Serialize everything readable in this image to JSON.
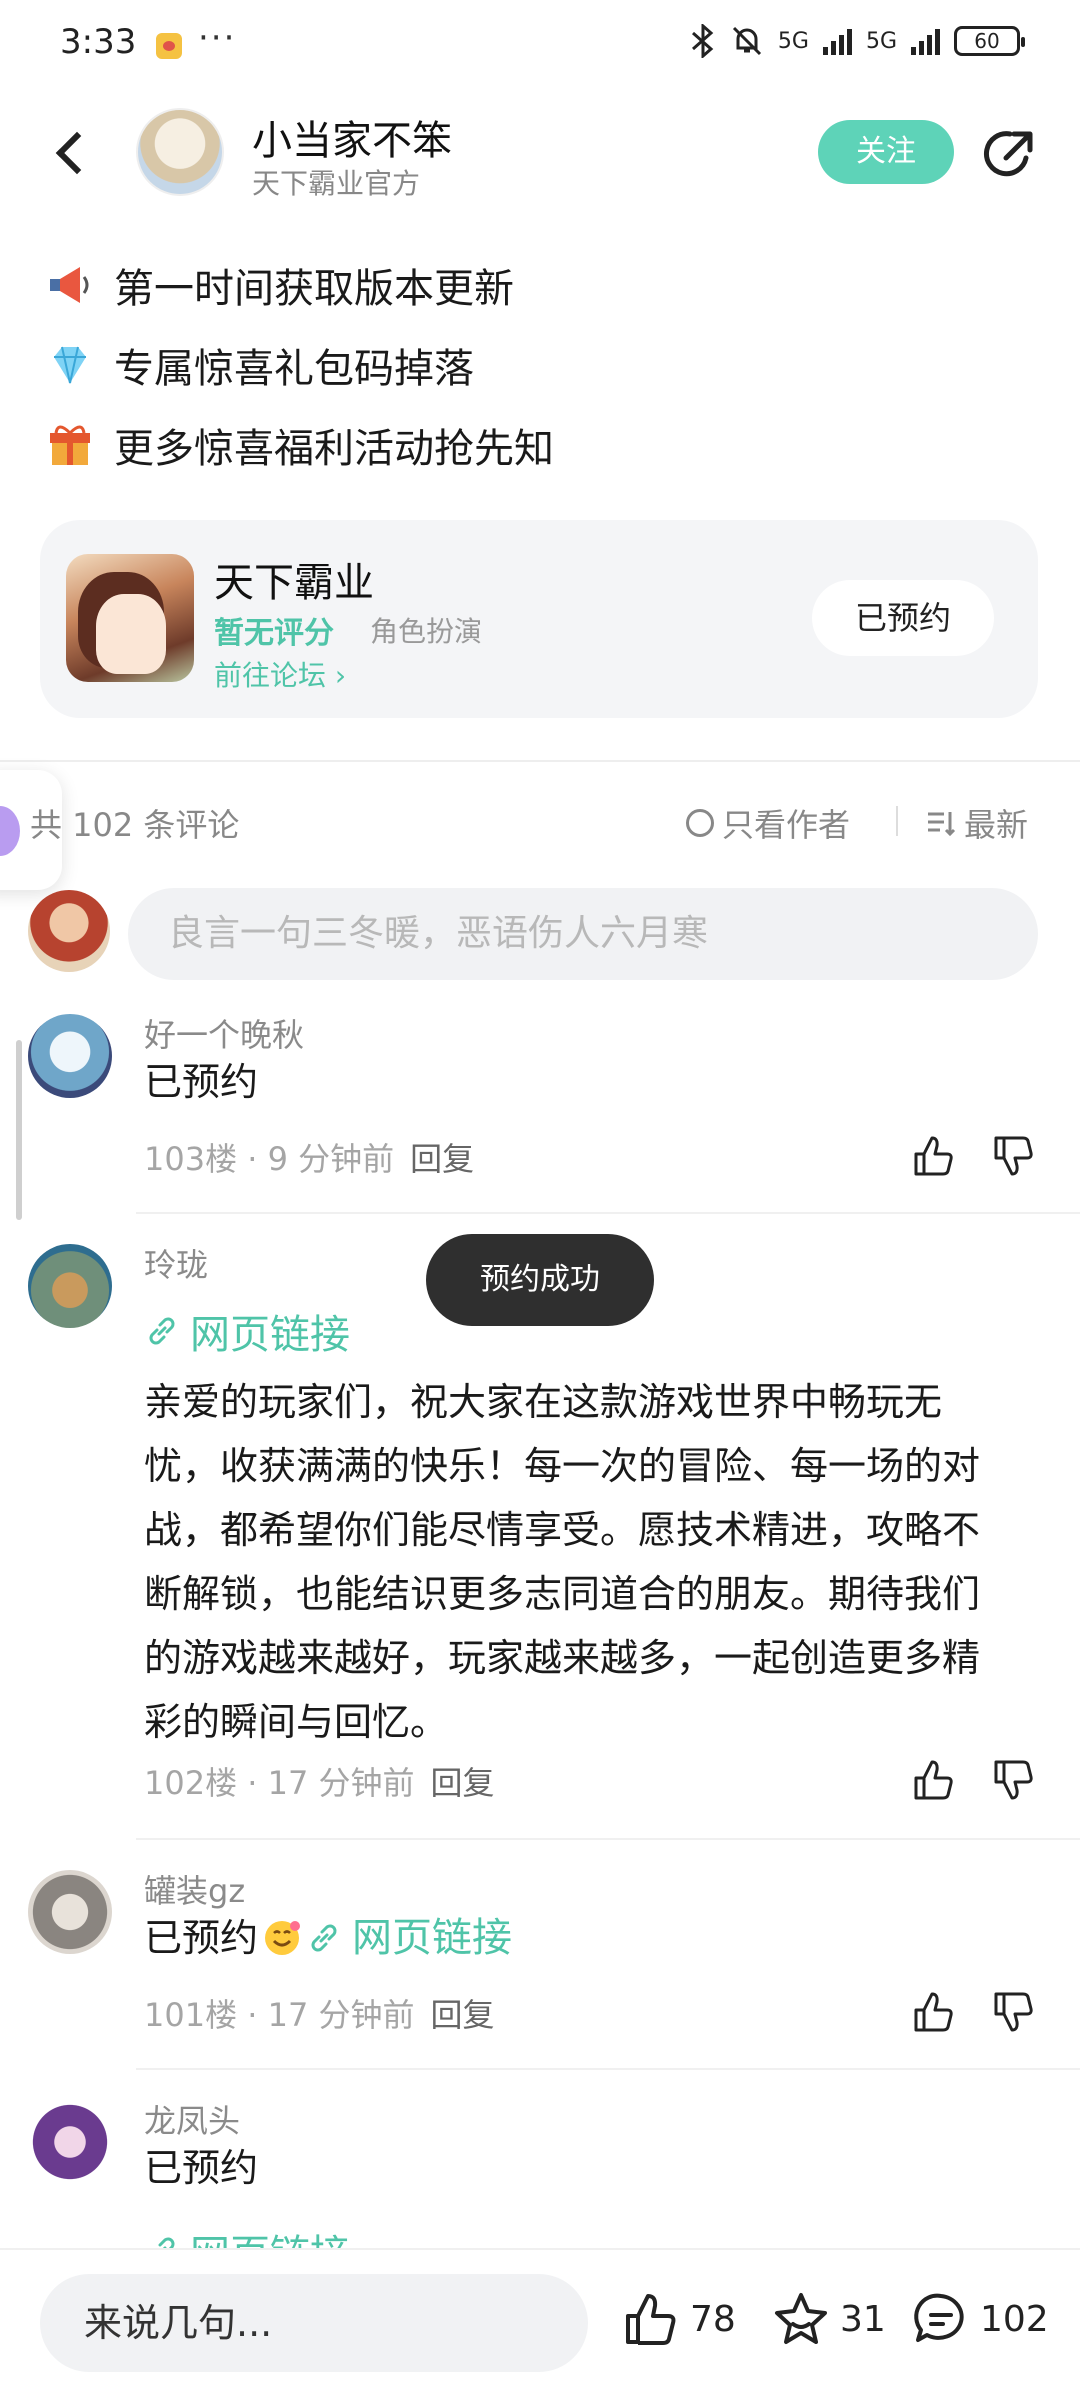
{
  "status_bar": {
    "time": "3:33",
    "more": "···",
    "network_1": "5G",
    "network_2": "5G",
    "battery": "60"
  },
  "header": {
    "title": "小当家不笨",
    "subtitle": "天下霸业官方",
    "follow_label": "关注"
  },
  "post": {
    "perks": [
      {
        "icon": "megaphone-icon",
        "text": "第一时间获取版本更新"
      },
      {
        "icon": "diamond-icon",
        "text": "专属惊喜礼包码掉落"
      },
      {
        "icon": "gift-icon",
        "text": "更多惊喜福利活动抢先知"
      }
    ]
  },
  "game_card": {
    "name": "天下霸业",
    "rating": "暂无评分",
    "genre": "角色扮演",
    "forum_link": "前往论坛",
    "reserve_label": "已预约"
  },
  "comments_header": {
    "count_label": "共 102 条评论",
    "only_author": "只看作者",
    "sort_label": "最新"
  },
  "comment_input": {
    "placeholder": "良言一句三冬暖，恶语伤人六月寒"
  },
  "comments": [
    {
      "user": "好一个晚秋",
      "body": "已预约",
      "floor": "103楼",
      "time": "9 分钟前",
      "reply": "回复"
    },
    {
      "user": "玲珑",
      "link": "网页链接",
      "body": "亲爱的玩家们，祝大家在这款游戏世界中畅玩无忧，收获满满的快乐！每一次的冒险、每一场的对战，都希望你们能尽情享受。愿技术精进，攻略不断解锁，也能结识更多志同道合的朋友。期待我们的游戏越来越好，玩家越来越多，一起创造更多精彩的瞬间与回忆。",
      "floor": "102楼",
      "time": "17 分钟前",
      "reply": "回复"
    },
    {
      "user": "罐装gz",
      "body": "已预约",
      "link": "网页链接",
      "floor": "101楼",
      "time": "17 分钟前",
      "reply": "回复"
    },
    {
      "user": "龙凤头",
      "body": "已预约",
      "link": "网页链接"
    }
  ],
  "toast": "预约成功",
  "bottom_bar": {
    "input_placeholder": "来说几句...",
    "likes": "78",
    "favorites": "31",
    "comments": "102"
  },
  "colors": {
    "accent": "#5ed3b8",
    "link": "#4fc4a8"
  }
}
